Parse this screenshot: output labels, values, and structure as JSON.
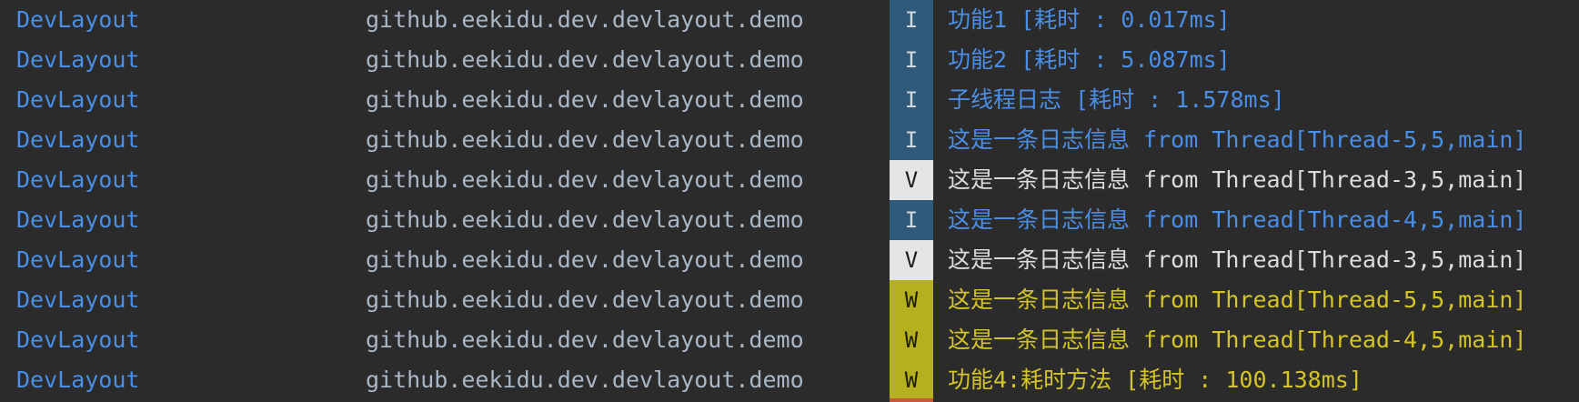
{
  "colors": {
    "background": "#2b2b2b",
    "tag": "#4a8ee6",
    "package": "#a9b7c6",
    "info_badge": "#2f5a7a",
    "verbose_badge": "#e5e5e5",
    "warn_badge": "#b4b01f",
    "info_text": "#4a8ee6",
    "verbose_text": "#dcdcdc",
    "warn_text": "#d4c42b",
    "error_badge": "#c8573f"
  },
  "rows": [
    {
      "tag": "DevLayout",
      "package": "github.eekidu.dev.devlayout.demo",
      "level": "I",
      "message": "功能1 [耗时 : 0.017ms]"
    },
    {
      "tag": "DevLayout",
      "package": "github.eekidu.dev.devlayout.demo",
      "level": "I",
      "message": "功能2 [耗时 : 5.087ms]"
    },
    {
      "tag": "DevLayout",
      "package": "github.eekidu.dev.devlayout.demo",
      "level": "I",
      "message": "子线程日志 [耗时 : 1.578ms]"
    },
    {
      "tag": "DevLayout",
      "package": "github.eekidu.dev.devlayout.demo",
      "level": "I",
      "message": "这是一条日志信息 from Thread[Thread-5,5,main]"
    },
    {
      "tag": "DevLayout",
      "package": "github.eekidu.dev.devlayout.demo",
      "level": "V",
      "message": "这是一条日志信息 from Thread[Thread-3,5,main]"
    },
    {
      "tag": "DevLayout",
      "package": "github.eekidu.dev.devlayout.demo",
      "level": "I",
      "message": "这是一条日志信息 from Thread[Thread-4,5,main]"
    },
    {
      "tag": "DevLayout",
      "package": "github.eekidu.dev.devlayout.demo",
      "level": "V",
      "message": "这是一条日志信息 from Thread[Thread-3,5,main]"
    },
    {
      "tag": "DevLayout",
      "package": "github.eekidu.dev.devlayout.demo",
      "level": "W",
      "message": "这是一条日志信息 from Thread[Thread-5,5,main]"
    },
    {
      "tag": "DevLayout",
      "package": "github.eekidu.dev.devlayout.demo",
      "level": "W",
      "message": "这是一条日志信息 from Thread[Thread-4,5,main]"
    },
    {
      "tag": "DevLayout",
      "package": "github.eekidu.dev.devlayout.demo",
      "level": "W",
      "message": "功能4:耗时方法 [耗时 : 100.138ms]"
    }
  ]
}
